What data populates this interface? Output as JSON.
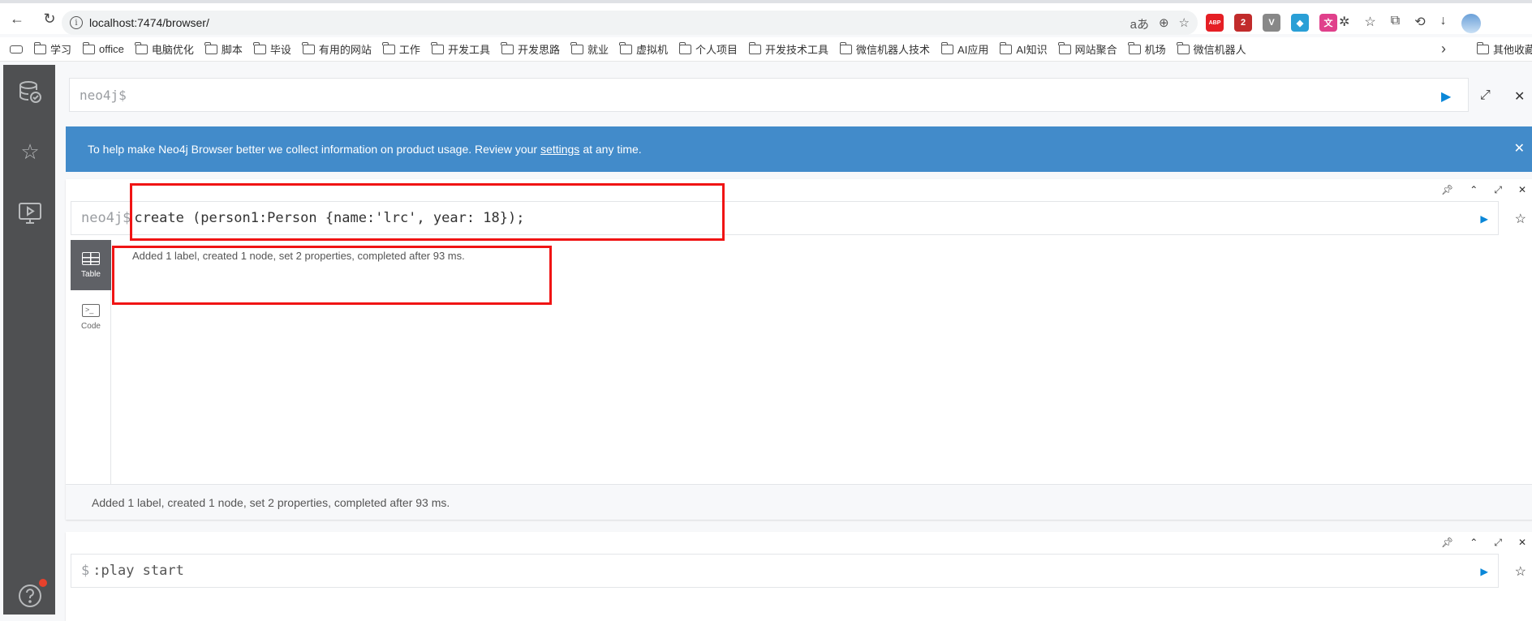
{
  "browser": {
    "url": "localhost:7474/browser/",
    "bookmarks": [
      "学习",
      "office",
      "电脑优化",
      "脚本",
      "毕设",
      "有用的网站",
      "工作",
      "开发工具",
      "开发思路",
      "就业",
      "虚拟机",
      "个人项目",
      "开发技术工具",
      "微信机器人技术",
      "AI应用",
      "AI知识",
      "网站聚合",
      "机场",
      "微信机器人"
    ],
    "other_bookmarks": "其他收藏",
    "more_chevron": "›",
    "extensions": [
      {
        "name": "abp-icon",
        "label": "ABP",
        "color": "#e51f25"
      },
      {
        "name": "extension-red-icon",
        "label": "2",
        "color": "#c12b2b"
      },
      {
        "name": "vpn-icon",
        "label": "V",
        "color": "#888888"
      },
      {
        "name": "shield-ext-icon",
        "label": "◆",
        "color": "#2a9fd6"
      },
      {
        "name": "translate-ext-icon",
        "label": "文",
        "color": "#e0408b"
      }
    ]
  },
  "editor_top": {
    "prompt": "neo4j$"
  },
  "banner": {
    "text_before": "To help make Neo4j Browser better we collect information on product usage. Review your",
    "link": "settings",
    "text_after": "at any time.",
    "close": "✕"
  },
  "frame1": {
    "prompt": "neo4j$",
    "code": "create (person1:Person {name:'lrc', year: 18});",
    "tabs": [
      {
        "label": "Table"
      },
      {
        "label": "Code"
      }
    ],
    "result": "Added 1 label, created 1 node, set 2 properties, completed after 93 ms.",
    "status": "Added 1 label, created 1 node, set 2 properties, completed after 93 ms."
  },
  "frame2": {
    "prompt": "$",
    "code": ":play start"
  },
  "colors": {
    "accent": "#0a87d8",
    "banner": "#428bca",
    "sidebar": "#4f5052",
    "highlight": "#f01414",
    "notification": "#e8412c"
  }
}
